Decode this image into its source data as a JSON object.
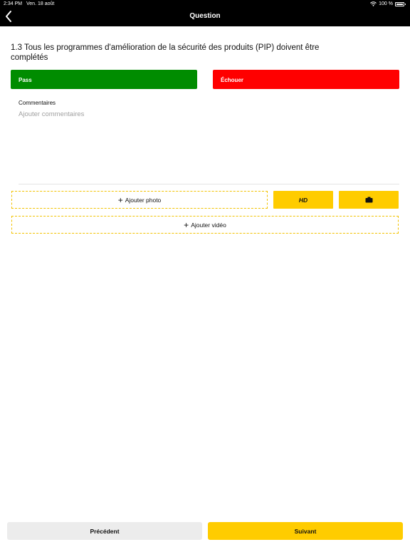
{
  "status_bar": {
    "time": "2:34 PM",
    "date": "Ven. 18 août",
    "battery": "100 %",
    "icons": [
      "wifi-icon",
      "battery-icon"
    ]
  },
  "nav": {
    "title": "Question",
    "back_icon": "chevron-left-icon"
  },
  "question": {
    "text": "1.3 Tous les programmes d'amélioration de la sécurité des produits (PIP) doivent être complétés"
  },
  "result_buttons": {
    "pass_label": "Pass",
    "fail_label": "Échouer",
    "pass_color": "#008c00",
    "fail_color": "#ff0000"
  },
  "comments": {
    "label": "Commentaires",
    "placeholder": "Ajouter commentaires",
    "value": ""
  },
  "media": {
    "add_photo_label": "Ajouter photo",
    "hd_label": "HD",
    "camera_icon": "camera-icon",
    "add_video_label": "Ajouter vidéo",
    "plus_icon": "plus-icon",
    "accent_color": "#ffcc00"
  },
  "footer": {
    "prev_label": "Précédent",
    "next_label": "Suivant"
  }
}
